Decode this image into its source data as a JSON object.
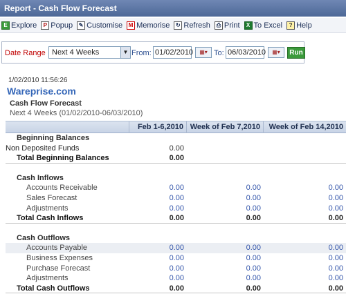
{
  "window": {
    "title": "Report - Cash Flow Forecast"
  },
  "toolbar": [
    {
      "label": "Explore",
      "icon": "explore-icon",
      "glyph": "E"
    },
    {
      "label": "Popup",
      "icon": "popup-icon",
      "glyph": "P"
    },
    {
      "label": "Customise",
      "icon": "customise-icon",
      "glyph": "✎"
    },
    {
      "label": "Memorise",
      "icon": "memorise-icon",
      "glyph": "M"
    },
    {
      "label": "Refresh",
      "icon": "refresh-icon",
      "glyph": "↻"
    },
    {
      "label": "Print",
      "icon": "print-icon",
      "glyph": "⎙"
    },
    {
      "label": "To Excel",
      "icon": "excel-icon",
      "glyph": "X"
    },
    {
      "label": "Help",
      "icon": "help-icon",
      "glyph": "?"
    }
  ],
  "filter": {
    "range_label": "Date Range",
    "range_value": "Next 4 Weeks",
    "from_label": "From:",
    "from_value": "01/02/2010",
    "to_label": "To:",
    "to_value": "06/03/2010",
    "run_label": "Run"
  },
  "report": {
    "timestamp": "1/02/2010 11:56:26",
    "company": "Wareprise.com",
    "title": "Cash Flow Forecast",
    "subtitle": "Next 4 Weeks (01/02/2010-06/03/2010)",
    "columns": [
      "Feb 1-6,2010",
      "Week of Feb 7,2010",
      "Week of Feb 14,2010"
    ],
    "rows": [
      {
        "kind": "sect",
        "label": "Beginning Balances",
        "values": []
      },
      {
        "kind": "plain",
        "label": "Non Deposited Funds",
        "values": [
          "0.00"
        ]
      },
      {
        "kind": "tot",
        "label": "Total Beginning Balances",
        "values": [
          "0.00"
        ]
      },
      {
        "kind": "gap"
      },
      {
        "kind": "sect",
        "label": "Cash Inflows",
        "values": []
      },
      {
        "kind": "item",
        "label": "Accounts Receivable",
        "values": [
          "0.00",
          "0.00",
          "0.00"
        ]
      },
      {
        "kind": "item",
        "label": "Sales Forecast",
        "values": [
          "0.00",
          "0.00",
          "0.00"
        ]
      },
      {
        "kind": "item",
        "label": "Adjustments",
        "values": [
          "0.00",
          "0.00",
          "0.00"
        ]
      },
      {
        "kind": "tot",
        "label": "Total Cash Inflows",
        "values": [
          "0.00",
          "0.00",
          "0.00"
        ]
      },
      {
        "kind": "gap"
      },
      {
        "kind": "sect",
        "label": "Cash Outflows",
        "values": []
      },
      {
        "kind": "item",
        "label": "Accounts Payable",
        "values": [
          "0.00",
          "0.00",
          "0.00"
        ],
        "shade": true
      },
      {
        "kind": "item",
        "label": "Business Expenses",
        "values": [
          "0.00",
          "0.00",
          "0.00"
        ]
      },
      {
        "kind": "item",
        "label": "Purchase Forecast",
        "values": [
          "0.00",
          "0.00",
          "0.00"
        ]
      },
      {
        "kind": "item",
        "label": "Adjustments",
        "values": [
          "0.00",
          "0.00",
          "0.00"
        ]
      },
      {
        "kind": "tot",
        "label": "Total Cash Outflows",
        "values": [
          "0.00",
          "0.00",
          "0.00"
        ]
      }
    ]
  }
}
